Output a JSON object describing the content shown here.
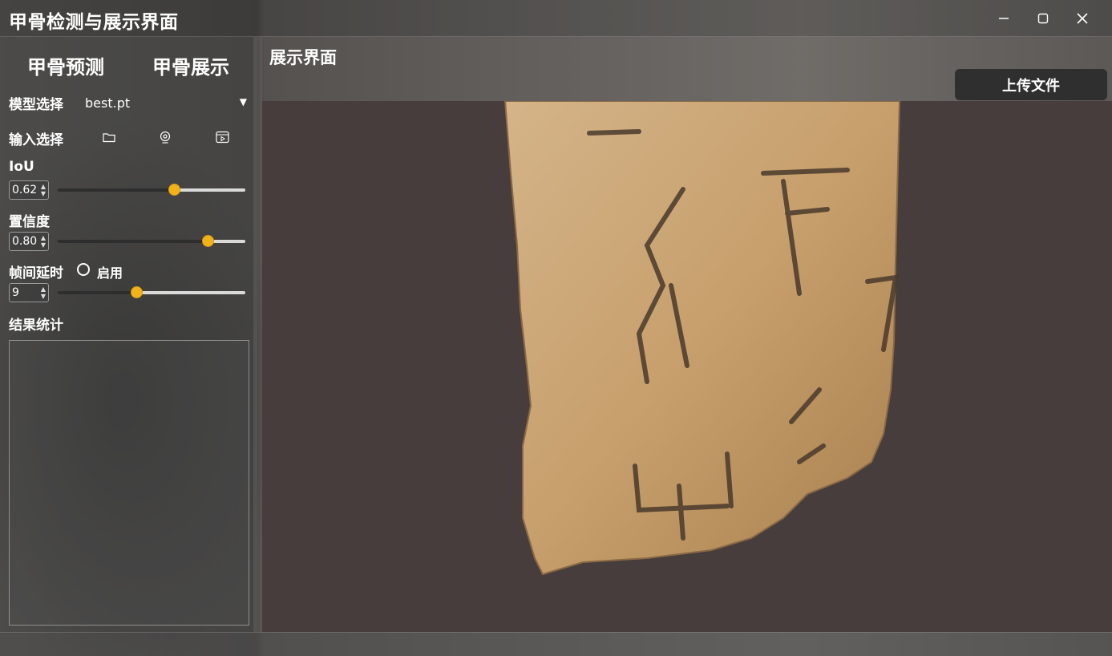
{
  "window": {
    "title": "甲骨检测与展示界面",
    "controls": [
      "minimize-icon",
      "maximize-icon",
      "close-icon"
    ]
  },
  "sidebar": {
    "tabs": [
      {
        "label": "甲骨预测"
      },
      {
        "label": "甲骨展示"
      }
    ],
    "model": {
      "label": "模型选择",
      "selected": "best.pt"
    },
    "input": {
      "label": "输入选择",
      "icons": [
        "folder-icon",
        "webcam-icon",
        "video-icon"
      ]
    },
    "iou": {
      "label": "IoU",
      "value": "0.62",
      "fraction": 0.62
    },
    "confidence": {
      "label": "置信度",
      "value": "0.80",
      "fraction": 0.8
    },
    "frame_delay": {
      "label": "帧间延时",
      "enable_label": "启用",
      "enabled": false,
      "value": "9",
      "fraction": 0.42
    },
    "results": {
      "label": "结果统计"
    }
  },
  "main": {
    "title": "展示界面",
    "upload_label": "上传文件"
  },
  "colors": {
    "accent": "#f2b21a",
    "display_bg": "#473d3d"
  }
}
